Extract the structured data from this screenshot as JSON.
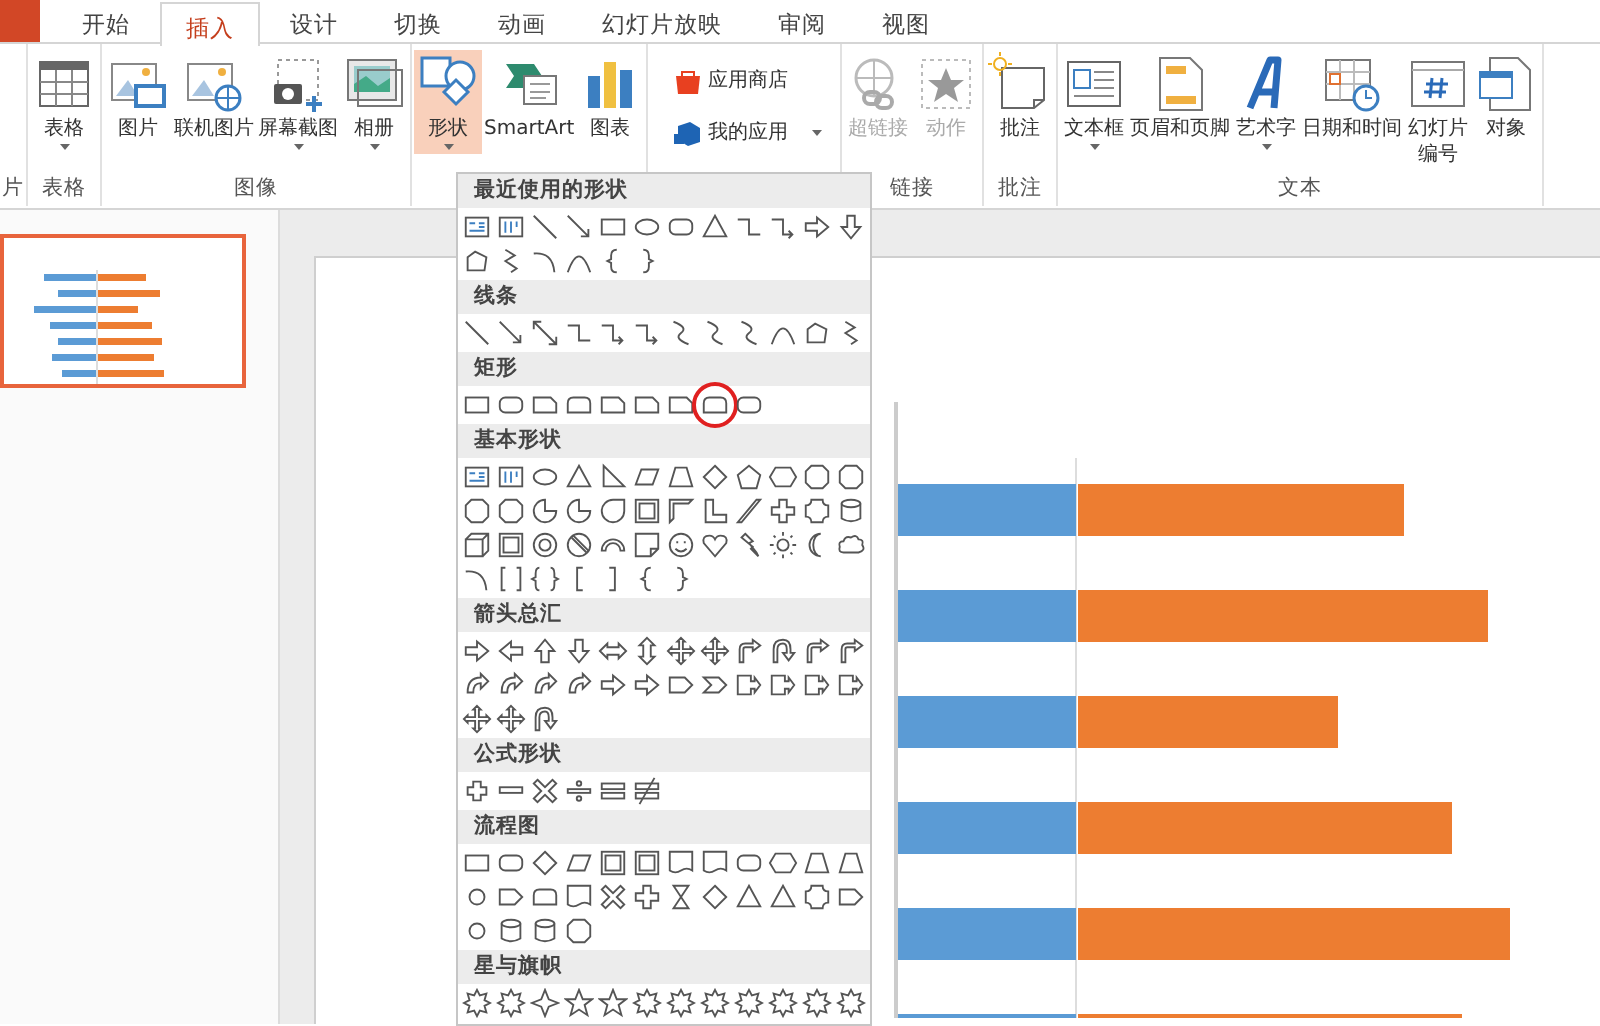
{
  "ribbon_tabs": [
    {
      "label": "开始",
      "selected": false
    },
    {
      "label": "插入",
      "selected": true
    },
    {
      "label": "设计",
      "selected": false
    },
    {
      "label": "切换",
      "selected": false
    },
    {
      "label": "动画",
      "selected": false
    },
    {
      "label": "幻灯片放映",
      "selected": false
    },
    {
      "label": "审阅",
      "selected": false
    },
    {
      "label": "视图",
      "selected": false
    }
  ],
  "ribbon_groups": [
    {
      "label": "片"
    },
    {
      "label": "表格",
      "buttons": [
        {
          "kind": "table",
          "label": "表格",
          "dropdown": true,
          "pressed": false,
          "disabled": false
        }
      ]
    },
    {
      "label": "图像",
      "buttons": [
        {
          "kind": "picture",
          "label": "图片",
          "dropdown": false,
          "pressed": false,
          "disabled": false
        },
        {
          "kind": "onlinepicture",
          "label": "联机图片",
          "dropdown": false,
          "pressed": false,
          "disabled": false
        },
        {
          "kind": "screenshot",
          "label": "屏幕截图",
          "dropdown": true,
          "pressed": false,
          "disabled": false
        },
        {
          "kind": "album",
          "label": "相册",
          "dropdown": true,
          "pressed": false,
          "disabled": false
        }
      ]
    },
    {
      "buttons": [
        {
          "kind": "shapes",
          "label": "形状",
          "dropdown": true,
          "pressed": true,
          "disabled": false
        },
        {
          "kind": "smartart",
          "label": "SmartArt",
          "dropdown": false,
          "pressed": false,
          "disabled": false
        },
        {
          "kind": "chart",
          "label": "图表",
          "dropdown": false,
          "pressed": false,
          "disabled": false
        }
      ]
    },
    {
      "buttons": [
        {
          "kind": "store",
          "label": "应用商店",
          "dropdown": false,
          "pressed": false,
          "disabled": false
        },
        {
          "kind": "apps",
          "label": "我的应用",
          "dropdown": true,
          "pressed": false,
          "disabled": false
        }
      ]
    },
    {
      "label": "链接",
      "buttons": [
        {
          "kind": "hyperlink",
          "label": "超链接",
          "dropdown": false,
          "pressed": false,
          "disabled": true
        },
        {
          "kind": "action",
          "label": "动作",
          "dropdown": false,
          "pressed": false,
          "disabled": true
        }
      ]
    },
    {
      "label": "批注",
      "buttons": [
        {
          "kind": "comment",
          "label": "批注",
          "dropdown": false,
          "pressed": false,
          "disabled": false
        }
      ]
    },
    {
      "label": "文本",
      "buttons": [
        {
          "kind": "textbox",
          "label": "文本框",
          "dropdown": true,
          "pressed": false,
          "disabled": false
        },
        {
          "kind": "headerfooter",
          "label": "页眉和页脚",
          "dropdown": false,
          "pressed": false,
          "disabled": false
        },
        {
          "kind": "wordart",
          "label": "艺术字",
          "dropdown": true,
          "pressed": false,
          "disabled": false
        },
        {
          "kind": "datetime",
          "label": "日期和时间",
          "dropdown": false,
          "pressed": false,
          "disabled": false
        },
        {
          "kind": "slidenumber",
          "label": "幻灯片编号",
          "dropdown": false,
          "pressed": false,
          "disabled": false
        },
        {
          "kind": "object",
          "label": "对象",
          "dropdown": false,
          "pressed": false,
          "disabled": false
        }
      ]
    }
  ],
  "slide_thumbnails": [
    {
      "selected": true
    }
  ],
  "shapes_gallery": [
    {
      "title": "最近使用的形状",
      "shapes": [
        {
          "kind": "textbox"
        },
        {
          "kind": "vtextbox"
        },
        {
          "kind": "line"
        },
        {
          "kind": "arrow"
        },
        {
          "kind": "rect"
        },
        {
          "kind": "ellipse"
        },
        {
          "kind": "roundrect"
        },
        {
          "kind": "triangle"
        },
        {
          "kind": "elbow"
        },
        {
          "kind": "elbowarrow"
        },
        {
          "kind": "rarrow"
        },
        {
          "kind": "darrow"
        },
        {
          "kind": "freeform"
        },
        {
          "kind": "scribble"
        },
        {
          "kind": "arc"
        },
        {
          "kind": "curve"
        },
        {
          "kind": "lbrace"
        },
        {
          "kind": "rbrace"
        }
      ]
    },
    {
      "title": "线条",
      "shapes": [
        {
          "kind": "line"
        },
        {
          "kind": "arrow"
        },
        {
          "kind": "dblarrow"
        },
        {
          "kind": "elbow"
        },
        {
          "kind": "elbowarrow"
        },
        {
          "kind": "elbowarrow"
        },
        {
          "kind": "scurve"
        },
        {
          "kind": "scurve"
        },
        {
          "kind": "scurve"
        },
        {
          "kind": "curve"
        },
        {
          "kind": "freeform"
        },
        {
          "kind": "scribble"
        }
      ]
    },
    {
      "title": "矩形",
      "shapes": [
        {
          "kind": "rect",
          "circled": false
        },
        {
          "kind": "roundrect",
          "circled": false
        },
        {
          "kind": "snip",
          "circled": false
        },
        {
          "kind": "roundtop",
          "circled": false
        },
        {
          "kind": "snip",
          "circled": false
        },
        {
          "kind": "snip",
          "circled": false
        },
        {
          "kind": "snip",
          "circled": false
        },
        {
          "kind": "roundtop",
          "circled": true
        },
        {
          "kind": "roundrect",
          "circled": false
        }
      ]
    },
    {
      "title": "基本形状",
      "shapes": [
        {
          "kind": "textbox"
        },
        {
          "kind": "vtextbox"
        },
        {
          "kind": "ellipse"
        },
        {
          "kind": "triangle"
        },
        {
          "kind": "rtriangle"
        },
        {
          "kind": "parallelogram"
        },
        {
          "kind": "trapezoid"
        },
        {
          "kind": "diamond"
        },
        {
          "kind": "pentagon"
        },
        {
          "kind": "hexagon"
        },
        {
          "kind": "octagon"
        },
        {
          "kind": "octagon"
        },
        {
          "kind": "octagon"
        },
        {
          "kind": "octagon"
        },
        {
          "kind": "pie"
        },
        {
          "kind": "pie"
        },
        {
          "kind": "teardrop"
        },
        {
          "kind": "frame"
        },
        {
          "kind": "halfframe"
        },
        {
          "kind": "lshape"
        },
        {
          "kind": "stripe"
        },
        {
          "kind": "cross"
        },
        {
          "kind": "plaque"
        },
        {
          "kind": "can"
        },
        {
          "kind": "cube"
        },
        {
          "kind": "frame"
        },
        {
          "kind": "donut"
        },
        {
          "kind": "nosymbol"
        },
        {
          "kind": "blockarc"
        },
        {
          "kind": "folded"
        },
        {
          "kind": "smiley"
        },
        {
          "kind": "heart"
        },
        {
          "kind": "lightning"
        },
        {
          "kind": "sun"
        },
        {
          "kind": "moon"
        },
        {
          "kind": "cloud"
        },
        {
          "kind": "arc"
        },
        {
          "kind": "dblbracket"
        },
        {
          "kind": "dblbrace"
        },
        {
          "kind": "lbracket"
        },
        {
          "kind": "rbracket"
        },
        {
          "kind": "lbrace"
        },
        {
          "kind": "rbrace"
        }
      ]
    },
    {
      "title": "箭头总汇",
      "shapes": [
        {
          "kind": "rarrow"
        },
        {
          "kind": "larrow"
        },
        {
          "kind": "uarrow"
        },
        {
          "kind": "darrow"
        },
        {
          "kind": "lrarrow"
        },
        {
          "kind": "udarrow"
        },
        {
          "kind": "quadarrow"
        },
        {
          "kind": "quadarrow"
        },
        {
          "kind": "bentarrow"
        },
        {
          "kind": "uturn"
        },
        {
          "kind": "bentarrow"
        },
        {
          "kind": "bentarrow"
        },
        {
          "kind": "curvedarrow"
        },
        {
          "kind": "curvedarrow"
        },
        {
          "kind": "curvedarrow"
        },
        {
          "kind": "curvedarrow"
        },
        {
          "kind": "rarrow"
        },
        {
          "kind": "rarrow"
        },
        {
          "kind": "homeplate"
        },
        {
          "kind": "chevron"
        },
        {
          "kind": "callout"
        },
        {
          "kind": "callout"
        },
        {
          "kind": "callout"
        },
        {
          "kind": "callout"
        },
        {
          "kind": "quadarrow"
        },
        {
          "kind": "quadarrow"
        },
        {
          "kind": "uturn"
        }
      ]
    },
    {
      "title": "公式形状",
      "shapes": [
        {
          "kind": "plus"
        },
        {
          "kind": "minus"
        },
        {
          "kind": "multiply"
        },
        {
          "kind": "divide"
        },
        {
          "kind": "equal"
        },
        {
          "kind": "notequal"
        }
      ]
    },
    {
      "title": "流程图",
      "shapes": [
        {
          "kind": "rect"
        },
        {
          "kind": "roundrect"
        },
        {
          "kind": "diamond"
        },
        {
          "kind": "parallelogram"
        },
        {
          "kind": "frame"
        },
        {
          "kind": "frame"
        },
        {
          "kind": "document"
        },
        {
          "kind": "document"
        },
        {
          "kind": "roundrect"
        },
        {
          "kind": "hexagon"
        },
        {
          "kind": "trapezoid"
        },
        {
          "kind": "trapezoid"
        },
        {
          "kind": "circle"
        },
        {
          "kind": "homeplate"
        },
        {
          "kind": "roundtop"
        },
        {
          "kind": "document"
        },
        {
          "kind": "multiply"
        },
        {
          "kind": "cross"
        },
        {
          "kind": "hourglass"
        },
        {
          "kind": "diamond"
        },
        {
          "kind": "triangle"
        },
        {
          "kind": "triangle"
        },
        {
          "kind": "plaque"
        },
        {
          "kind": "homeplate"
        },
        {
          "kind": "circle"
        },
        {
          "kind": "can"
        },
        {
          "kind": "can"
        },
        {
          "kind": "octagon"
        }
      ]
    },
    {
      "title": "星与旗帜",
      "shapes": [
        {
          "kind": "burst"
        },
        {
          "kind": "burst"
        },
        {
          "kind": "star4"
        },
        {
          "kind": "star5"
        },
        {
          "kind": "star5"
        },
        {
          "kind": "burst"
        },
        {
          "kind": "burst"
        },
        {
          "kind": "burst"
        },
        {
          "kind": "burst"
        },
        {
          "kind": "burst"
        },
        {
          "kind": "burst"
        },
        {
          "kind": "burst"
        }
      ]
    }
  ]
}
